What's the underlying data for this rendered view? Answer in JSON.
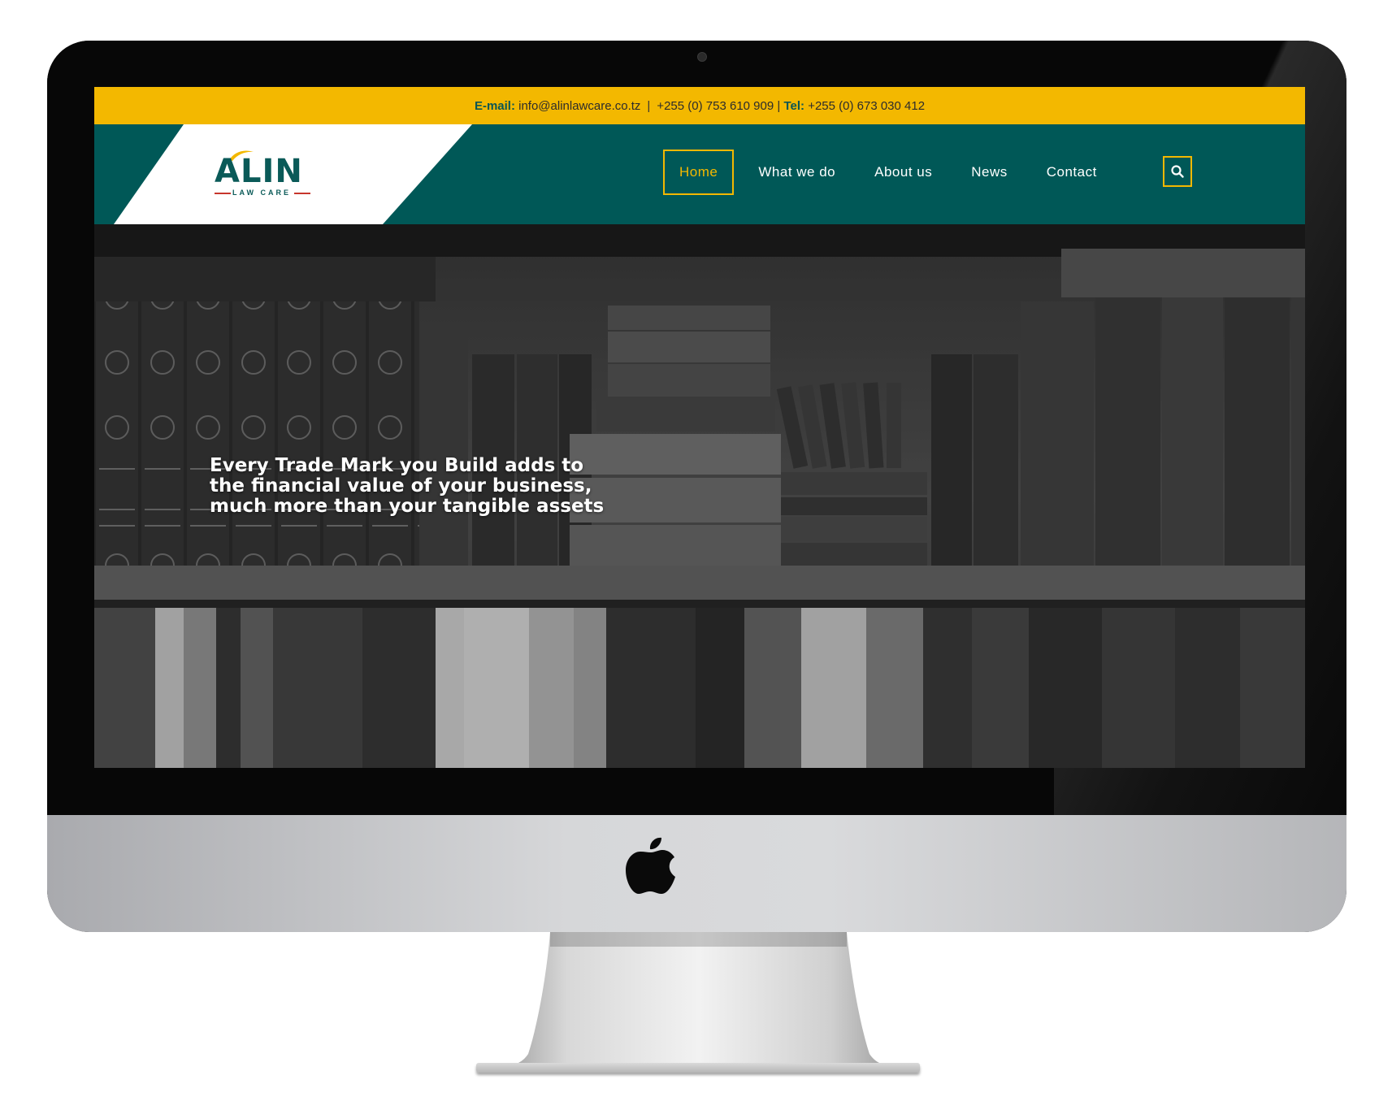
{
  "topbar": {
    "email_label": "E-mail:",
    "email_value": "info@alinlawcare.co.tz",
    "separator": "|",
    "phone1": "+255 (0) 753 610 909",
    "tel_label": "Tel:",
    "phone2": "+255 (0) 673 030 412"
  },
  "logo": {
    "word": "ALIN",
    "sub": "LAW CARE"
  },
  "nav": {
    "items": [
      {
        "label": "Home",
        "active": true
      },
      {
        "label": "What we do"
      },
      {
        "label": "About us"
      },
      {
        "label": "News"
      },
      {
        "label": "Contact"
      }
    ],
    "search_icon": "search-icon"
  },
  "hero": {
    "headline": "Every Trade Mark you Build adds to the financial value of your business, much more than your tangible assets"
  },
  "colors": {
    "accent_yellow": "#f3b800",
    "brand_teal": "#005857",
    "logo_red": "#c7362c"
  },
  "device": {
    "logo_icon": "apple-logo-icon"
  }
}
